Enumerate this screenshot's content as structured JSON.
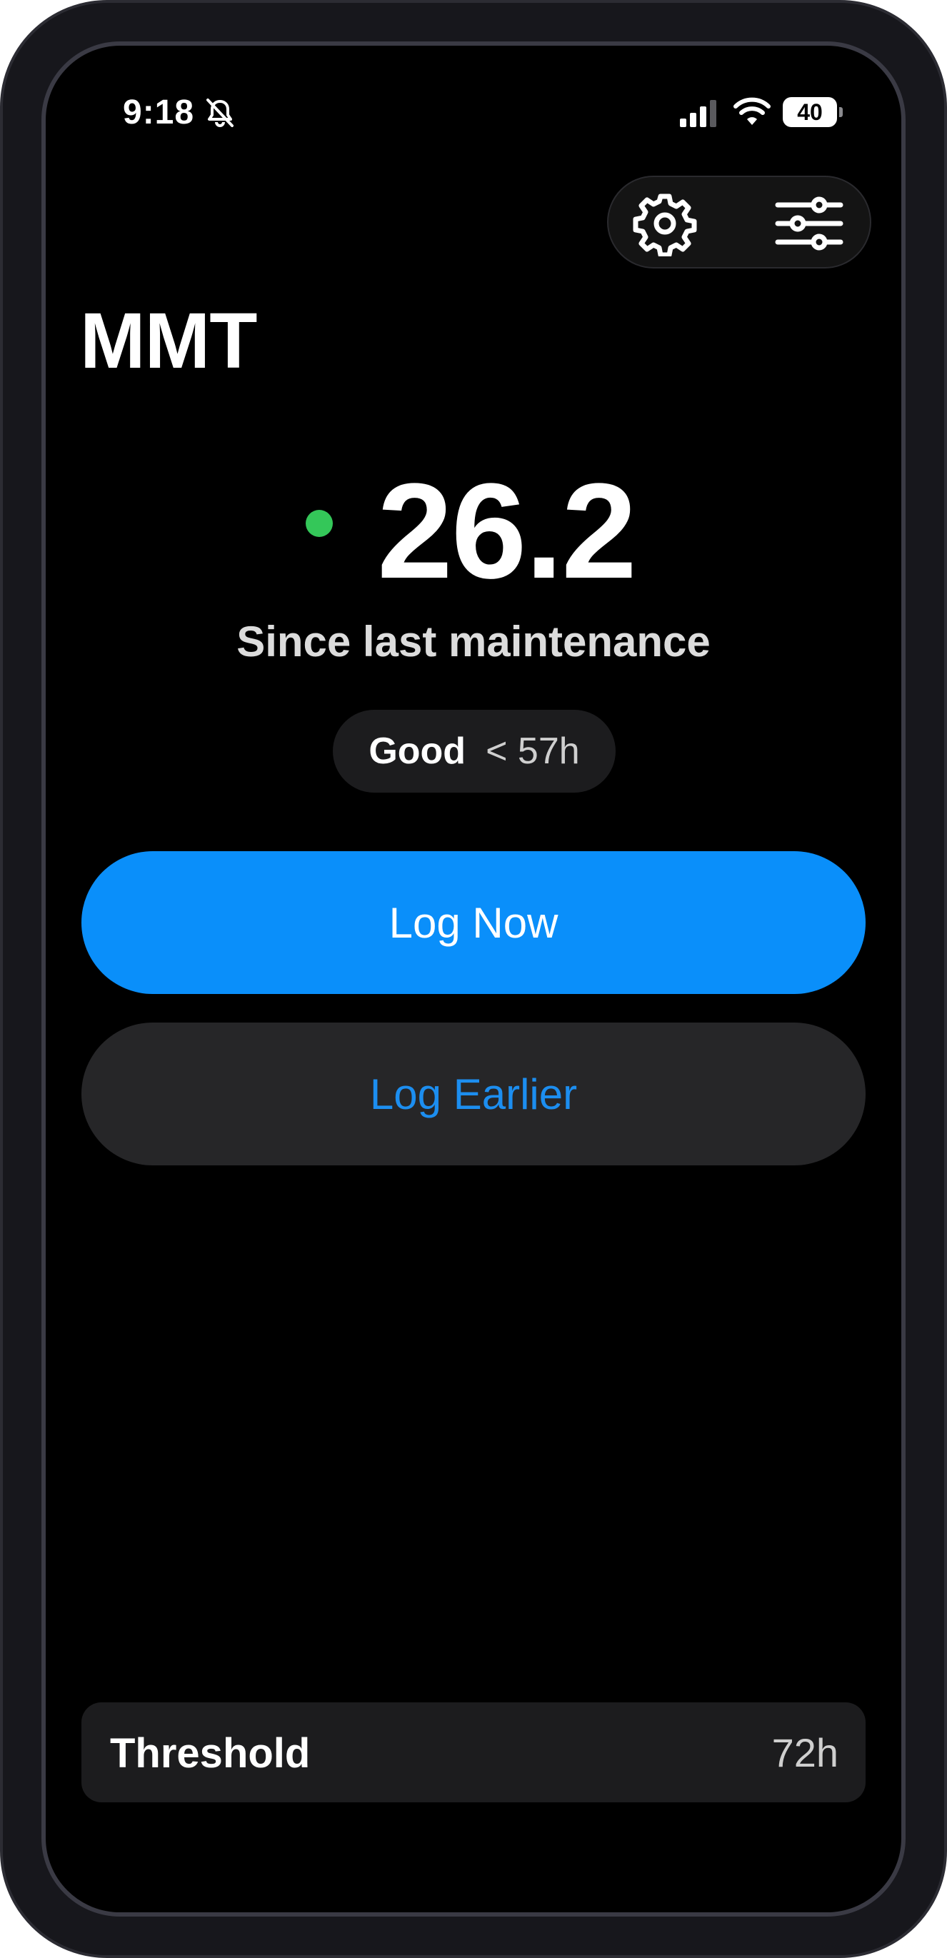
{
  "status_bar": {
    "time": "9:18",
    "battery": "40",
    "icons": [
      "bell-slash-icon",
      "cellular-signal-icon",
      "wifi-icon",
      "battery-icon"
    ]
  },
  "toolbar": {
    "icons": [
      "gear-icon",
      "sliders-icon"
    ]
  },
  "app": {
    "title": "MMT"
  },
  "summary": {
    "hours": "26.2",
    "caption": "Since last maintenance",
    "status_color": "#34c759",
    "status_label": "Good",
    "status_range": "< 57h"
  },
  "actions": {
    "log_now": "Log Now",
    "log_earlier": "Log Earlier",
    "primary_color": "#0a8ffa"
  },
  "threshold": {
    "label": "Threshold",
    "value": "72h"
  }
}
